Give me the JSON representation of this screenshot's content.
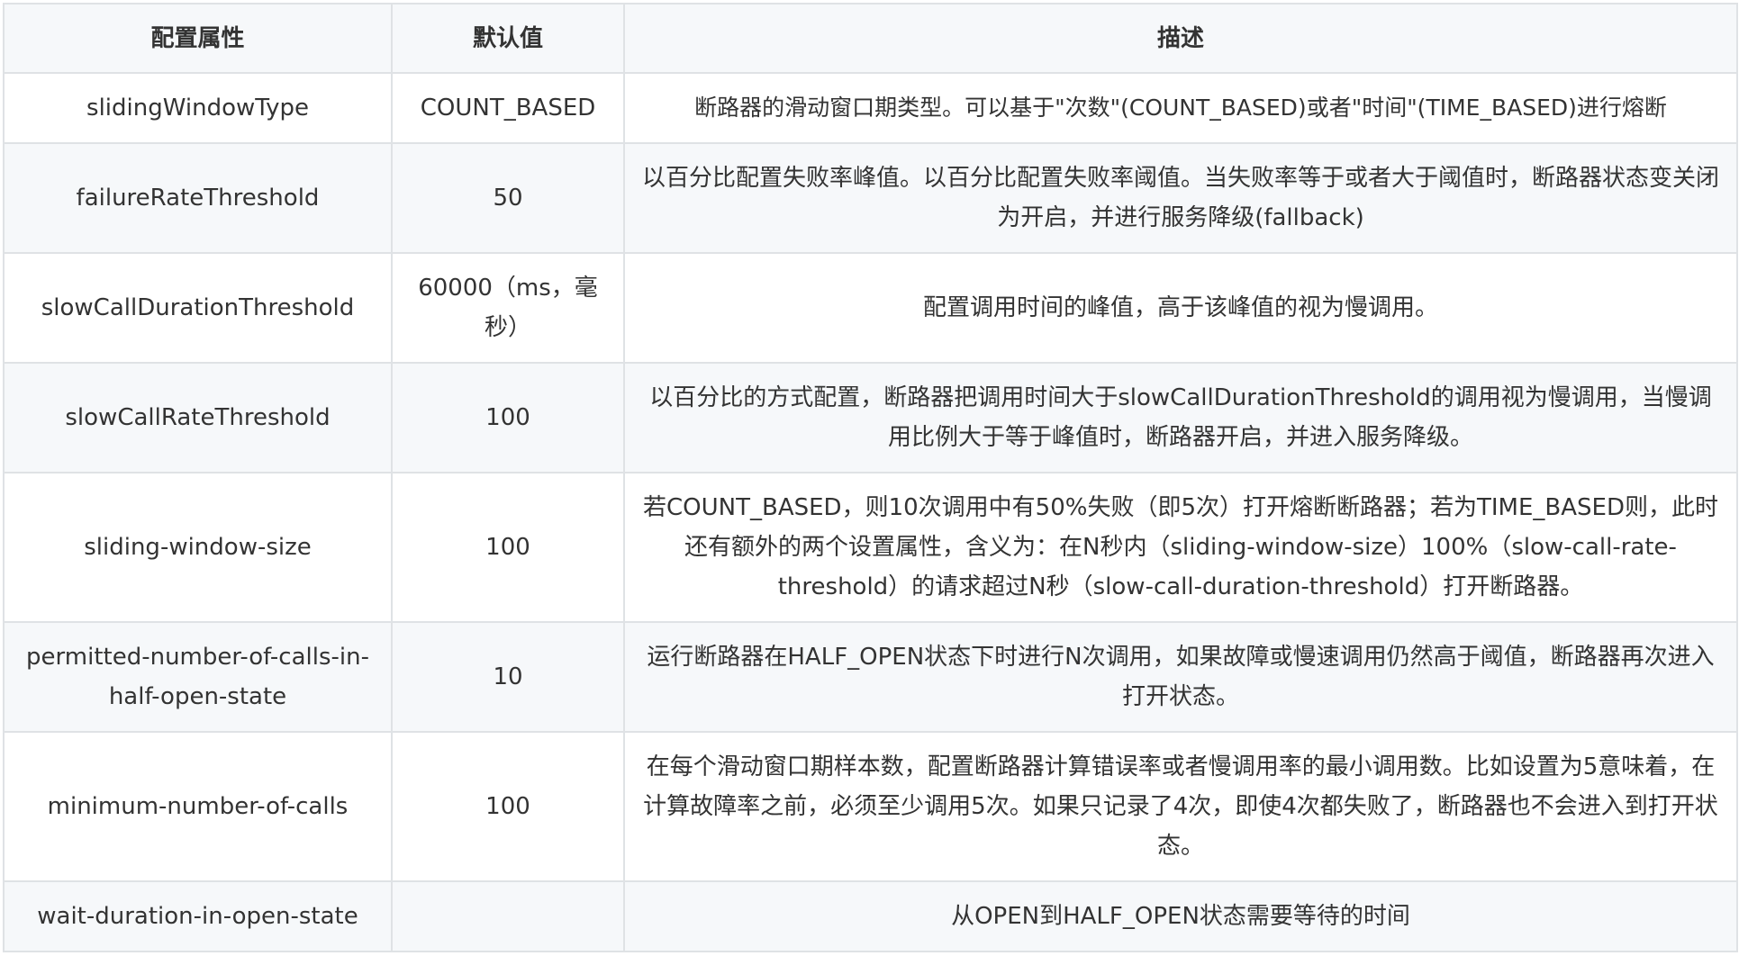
{
  "table": {
    "headers": {
      "property": "配置属性",
      "default": "默认值",
      "description": "描述"
    },
    "rows": [
      {
        "property": "slidingWindowType",
        "default": "COUNT_BASED",
        "description": "断路器的滑动窗口期类型。可以基于\"次数\"(COUNT_BASED)或者\"时间\"(TIME_BASED)进行熔断"
      },
      {
        "property": "failureRateThreshold",
        "default": "50",
        "description": "以百分比配置失败率峰值。以百分比配置失败率阈值。当失败率等于或者大于阈值时，断路器状态变关闭为开启，并进行服务降级(fallback)"
      },
      {
        "property": "slowCallDurationThreshold",
        "default": "60000（ms，毫秒）",
        "description": "配置调用时间的峰值，高于该峰值的视为慢调用。"
      },
      {
        "property": "slowCallRateThreshold",
        "default": "100",
        "description": "以百分比的方式配置，断路器把调用时间大于slowCallDurationThreshold的调用视为慢调用，当慢调用比例大于等于峰值时，断路器开启，并进入服务降级。"
      },
      {
        "property": "sliding-window-size",
        "default": "100",
        "description": "若COUNT_BASED，则10次调用中有50%失败（即5次）打开熔断断路器；若为TIME_BASED则，此时还有额外的两个设置属性，含义为：在N秒内（sliding-window-size）100%（slow-call-rate-threshold）的请求超过N秒（slow-call-duration-threshold）打开断路器。"
      },
      {
        "property": "permitted-number-of-calls-in-half-open-state",
        "default": "10",
        "description": "运行断路器在HALF_OPEN状态下时进行N次调用，如果故障或慢速调用仍然高于阈值，断路器再次进入打开状态。"
      },
      {
        "property": "minimum-number-of-calls",
        "default": "100",
        "description": "在每个滑动窗口期样本数，配置断路器计算错误率或者慢调用率的最小调用数。比如设置为5意味着，在计算故障率之前，必须至少调用5次。如果只记录了4次，即使4次都失败了，断路器也不会进入到打开状态。"
      },
      {
        "property": "wait-duration-in-open-state",
        "default": "",
        "description": "从OPEN到HALF_OPEN状态需要等待的时间"
      }
    ]
  }
}
